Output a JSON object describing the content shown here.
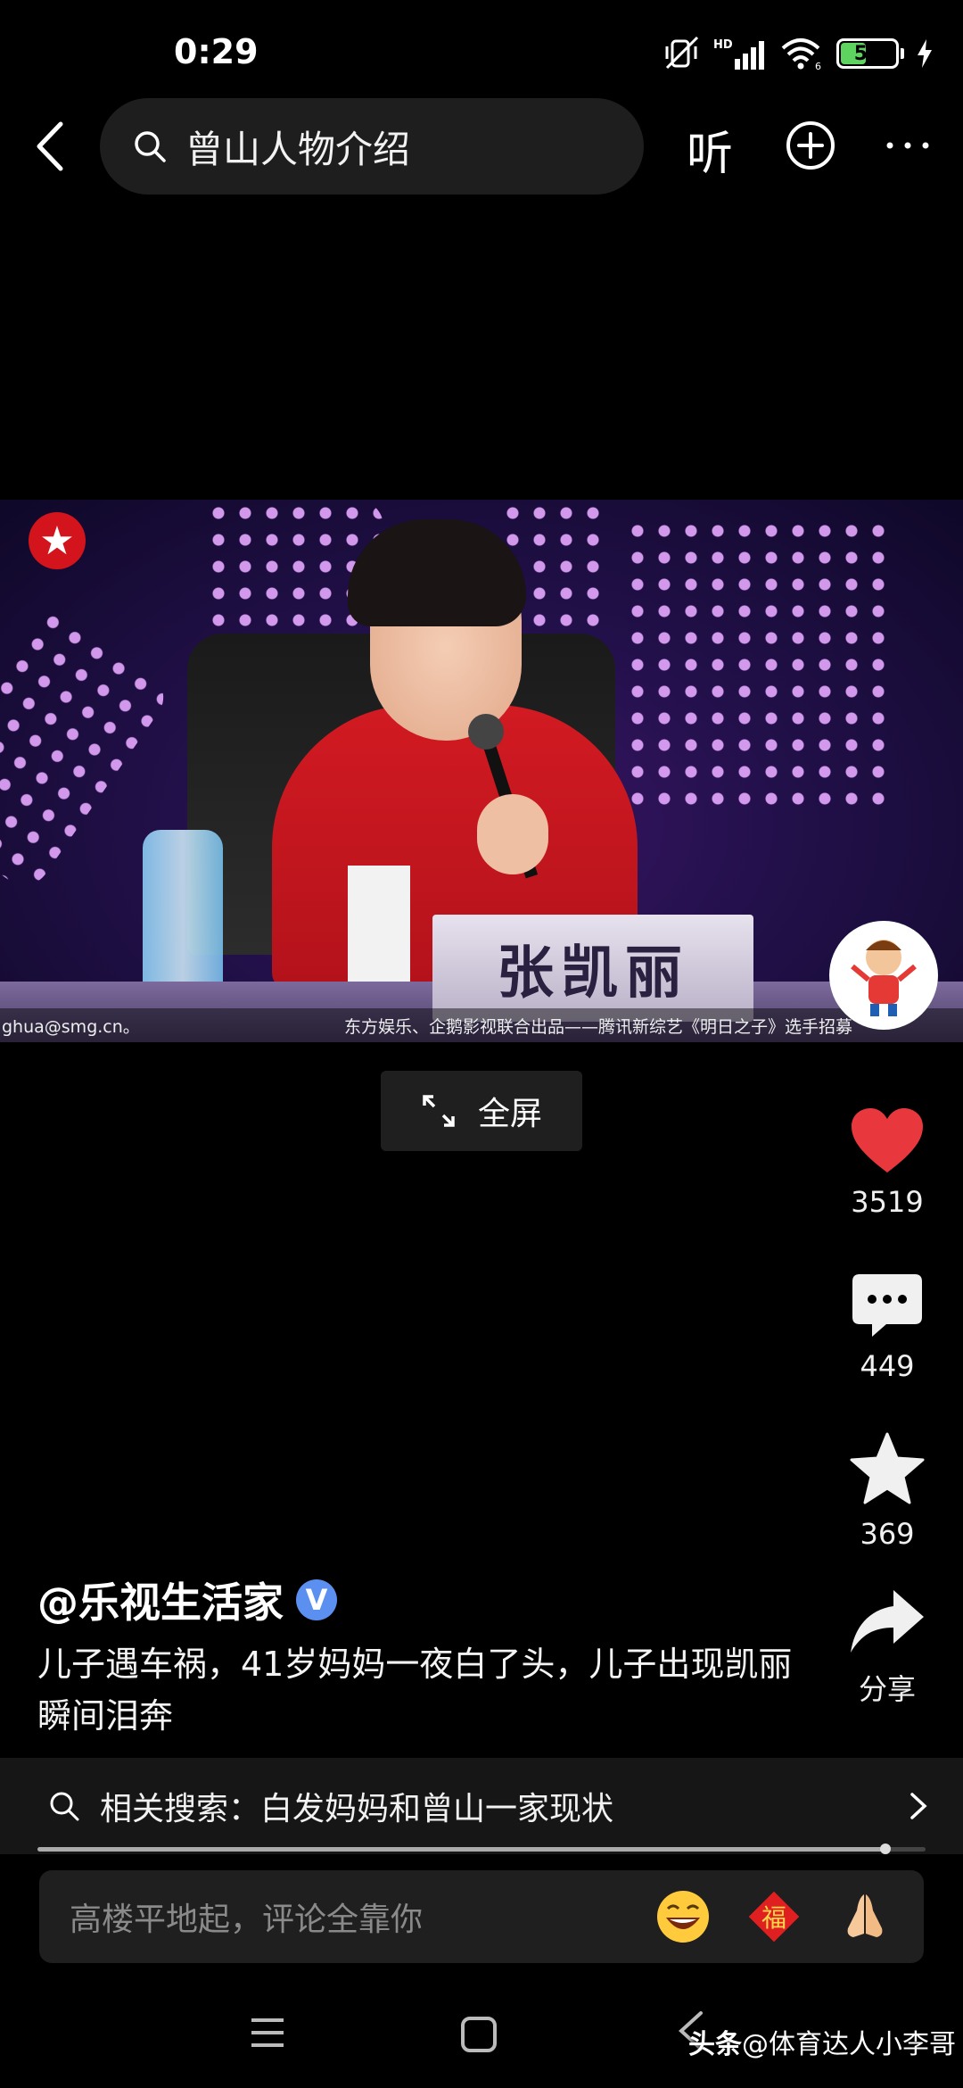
{
  "status_bar": {
    "time": "0:29",
    "battery_level": "50",
    "battery_percent": 50,
    "network": "HD",
    "wifi_sub": "6"
  },
  "top_nav": {
    "search_query": "曾山人物介绍",
    "listen_label": "听"
  },
  "video": {
    "nameplate": "张凯丽",
    "ticker_left": "ghua@smg.cn。",
    "ticker_right": "东方娱乐、企鹅影视联合出品——腾讯新综艺《明日之子》选手招募",
    "fullscreen_label": "全屏"
  },
  "rail": {
    "likes": "3519",
    "comments": "449",
    "favorites": "369",
    "share_label": "分享"
  },
  "post": {
    "author": "@乐视生活家",
    "verified_mark": "V",
    "caption": "儿子遇车祸，41岁妈妈一夜白了头，儿子出现凯丽瞬间泪奔"
  },
  "related": {
    "text": "相关搜索：白发妈妈和曾山一家现状"
  },
  "progress": {
    "fraction": 0.955
  },
  "comment": {
    "placeholder": "高楼平地起，评论全靠你",
    "emoji_1": "grinning-face-icon",
    "emoji_2": "fu-charm-icon",
    "emoji_3": "folded-hands-icon"
  },
  "watermark": {
    "brand": "头条",
    "handle": "@体育达人小李哥"
  },
  "colors": {
    "like_red": "#e8383d",
    "verified_blue": "#5b8ff0",
    "battery_green": "#5fd35f"
  }
}
